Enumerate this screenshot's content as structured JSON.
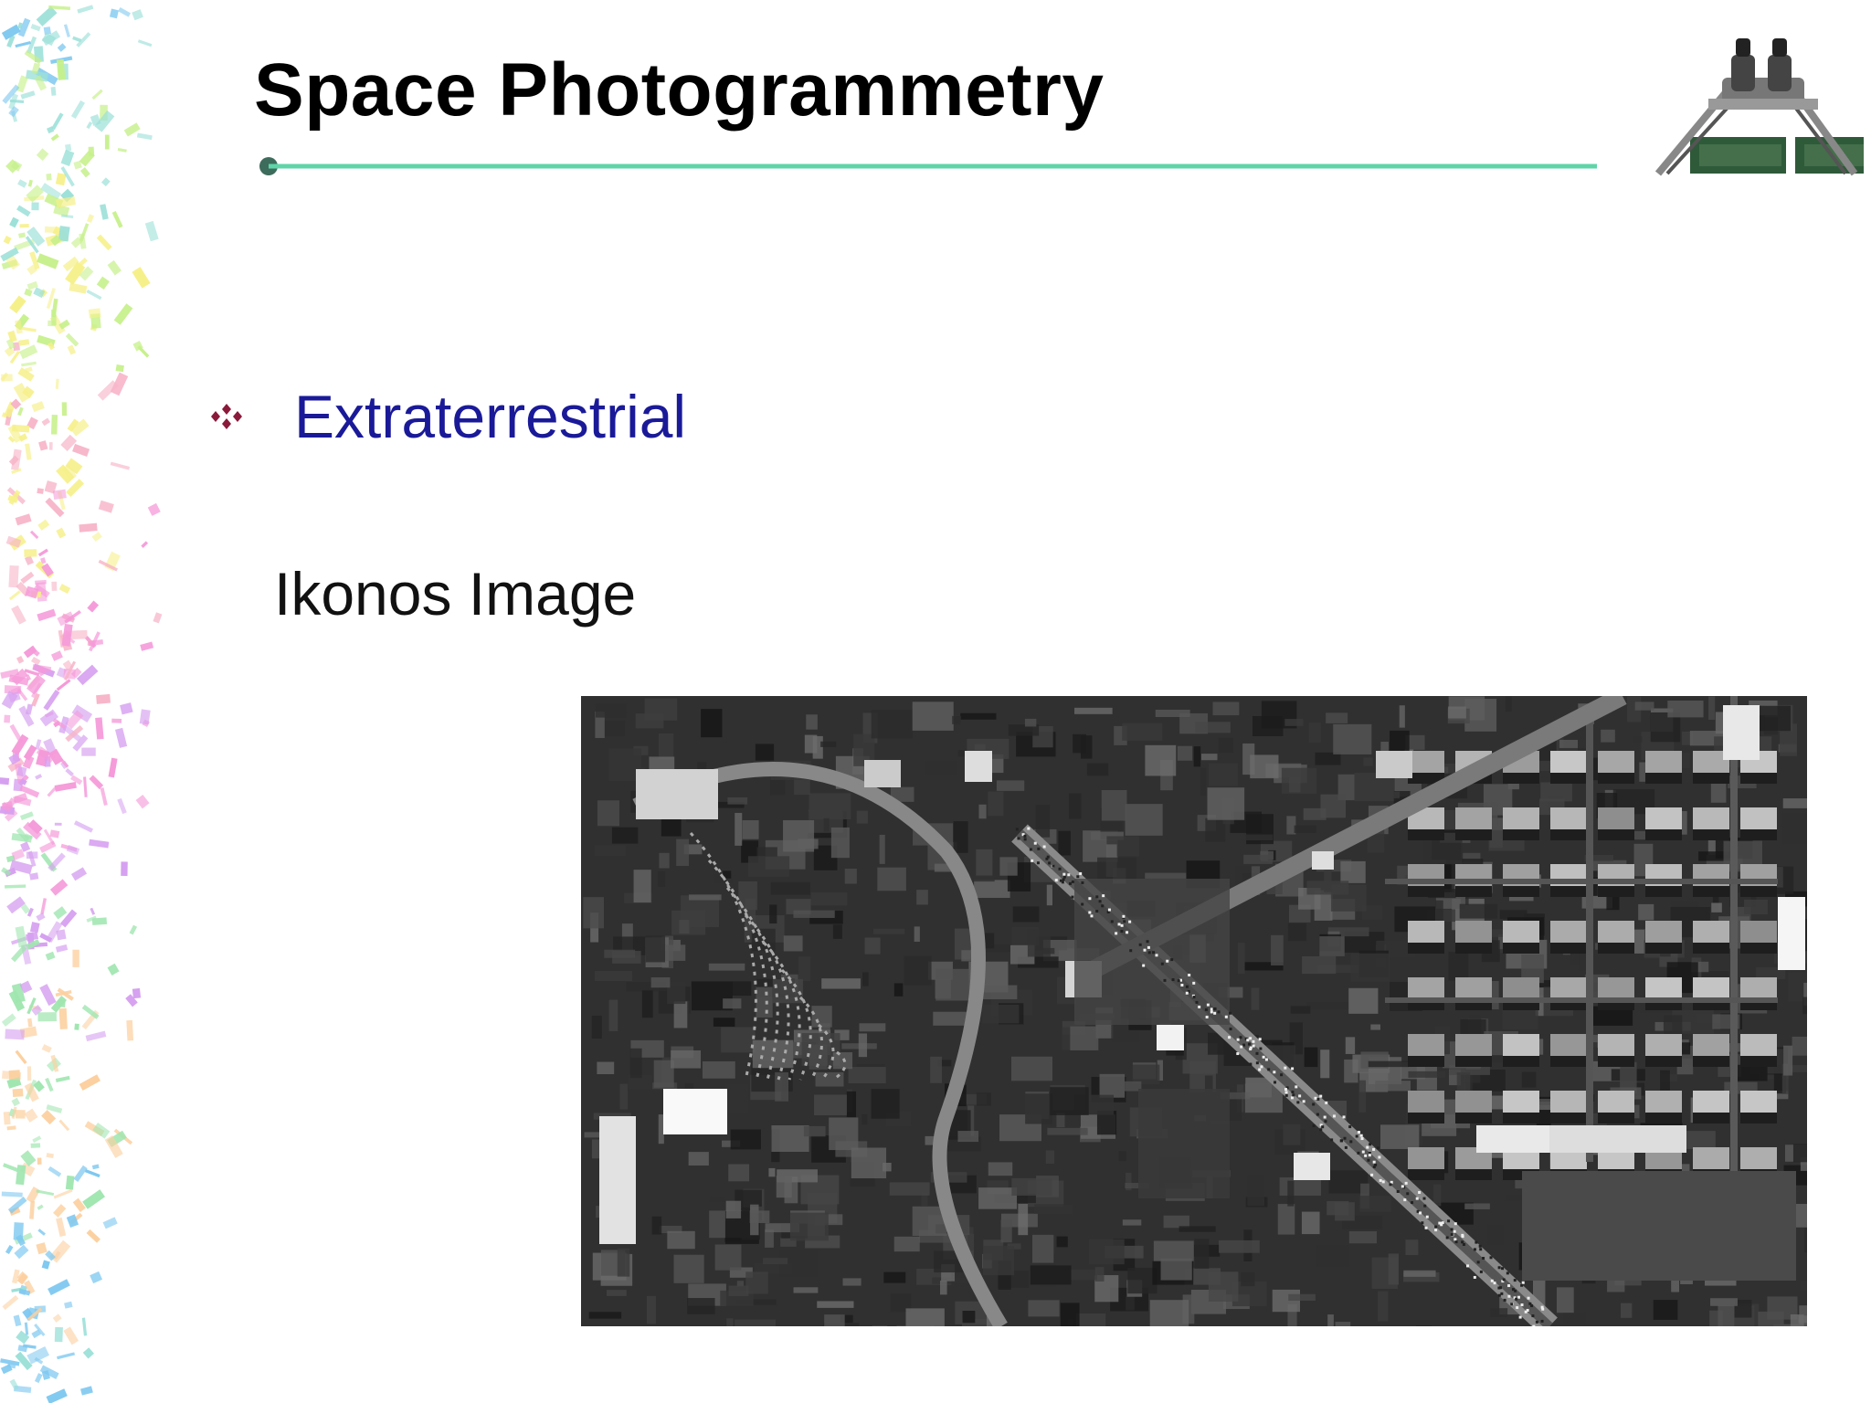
{
  "slide": {
    "title": "Space Photogrammetry",
    "bullet": {
      "icon": "four-diamond-bullet-icon",
      "text": "Extraterrestrial",
      "color": "#1a1a99",
      "icon_color": "#8b1a3a"
    },
    "subtext": "Ikonos Image",
    "rule_color": "#5fd4a8",
    "logo_icon": "stereoscope-icon",
    "image_icon": "satellite-image"
  }
}
